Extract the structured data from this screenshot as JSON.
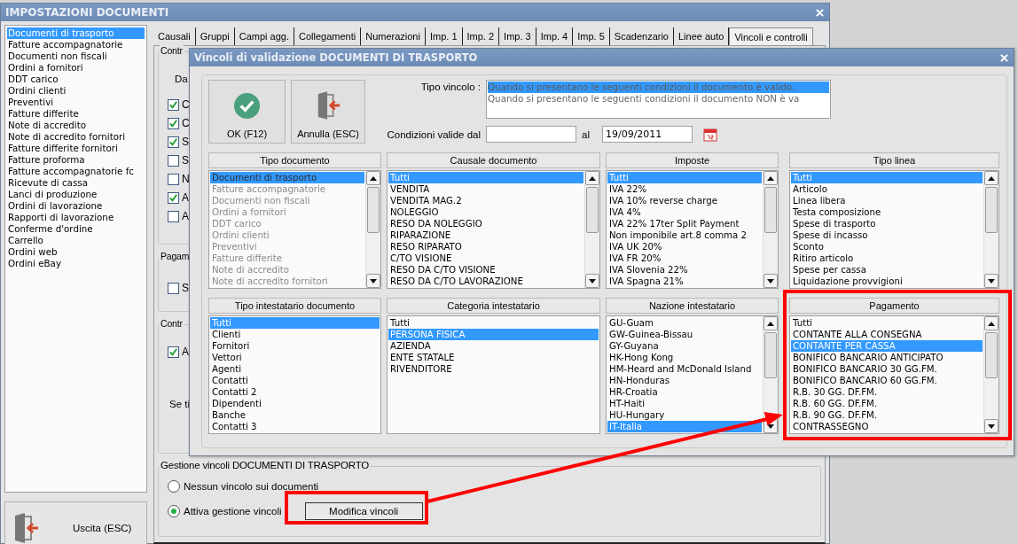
{
  "window": {
    "title": "IMPOSTAZIONI DOCUMENTI"
  },
  "document_types": [
    {
      "label": "Documenti di trasporto",
      "selected": true
    },
    {
      "label": "Fatture accompagnatorie",
      "selected": false
    },
    {
      "label": "Documenti non fiscali",
      "selected": false
    },
    {
      "label": "Ordini a fornitori",
      "selected": false
    },
    {
      "label": "DDT carico",
      "selected": false
    },
    {
      "label": "Ordini clienti",
      "selected": false
    },
    {
      "label": "Preventivi",
      "selected": false
    },
    {
      "label": "Fatture differite",
      "selected": false
    },
    {
      "label": "Note di accredito",
      "selected": false
    },
    {
      "label": "Note di accredito fornitori",
      "selected": false
    },
    {
      "label": "Fatture differite fornitori",
      "selected": false
    },
    {
      "label": "Fatture proforma",
      "selected": false
    },
    {
      "label": "Fatture accompagnatorie fc",
      "selected": false
    },
    {
      "label": "Ricevute di cassa",
      "selected": false
    },
    {
      "label": "Lanci di produzione",
      "selected": false
    },
    {
      "label": "Ordini di lavorazione",
      "selected": false
    },
    {
      "label": "Rapporti di lavorazione",
      "selected": false
    },
    {
      "label": "Conferme d'ordine",
      "selected": false
    },
    {
      "label": "Carrello",
      "selected": false
    },
    {
      "label": "Ordini web",
      "selected": false
    },
    {
      "label": "Ordini eBay",
      "selected": false
    }
  ],
  "exit_button": "Uscita (ESC)",
  "tabs": [
    {
      "label": "Causali",
      "selected": false
    },
    {
      "label": "Gruppi",
      "selected": false
    },
    {
      "label": "Campi agg.",
      "selected": false
    },
    {
      "label": "Collegamenti",
      "selected": false
    },
    {
      "label": "Numerazioni",
      "selected": false
    },
    {
      "label": "Imp. 1",
      "selected": false
    },
    {
      "label": "Imp. 2",
      "selected": false
    },
    {
      "label": "Imp. 3",
      "selected": false
    },
    {
      "label": "Imp. 4",
      "selected": false
    },
    {
      "label": "Imp. 5",
      "selected": false
    },
    {
      "label": "Scadenzario",
      "selected": false
    },
    {
      "label": "Linee auto",
      "selected": false
    },
    {
      "label": "Vincoli e controlli",
      "selected": true
    }
  ],
  "groups": [
    {
      "legend": "Contr",
      "items": [
        {
          "kind": "label",
          "text": "Da"
        },
        {
          "kind": "checkbox",
          "text": "C",
          "checked": true
        },
        {
          "kind": "checkbox",
          "text": "C",
          "checked": true
        },
        {
          "kind": "checkbox",
          "text": "S",
          "checked": true
        },
        {
          "kind": "checkbox",
          "text": "S",
          "checked": false
        },
        {
          "kind": "checkbox",
          "text": "N",
          "checked": false
        },
        {
          "kind": "checkbox",
          "text": "A",
          "checked": true
        },
        {
          "kind": "checkbox",
          "text": "A",
          "checked": false
        }
      ]
    },
    {
      "legend": "Pagam",
      "items": [
        {
          "kind": "checkbox",
          "text": "S",
          "checked": false
        }
      ]
    },
    {
      "legend": "Contr",
      "items": [
        {
          "kind": "checkbox",
          "text": "A",
          "checked": true
        },
        {
          "kind": "label",
          "text": "Se ti"
        }
      ]
    }
  ],
  "constraints_group": {
    "legend": "Gestione vincoli DOCUMENTI DI TRASPORTO",
    "options": [
      {
        "label": "Nessun vincolo sui documenti",
        "selected": false
      },
      {
        "label": "Attiva gestione vincoli",
        "selected": true
      }
    ],
    "button": "Modifica vincoli"
  },
  "dialog": {
    "title": "Vincoli di validazione DOCUMENTI DI TRASPORTO",
    "ok_button": "OK (F12)",
    "cancel_button": "Annulla (ESC)",
    "constraint_type": {
      "label": "Tipo vincolo :",
      "options": [
        {
          "label": "Quando si presentano le seguenti condizioni il documento è valido.",
          "selected": true
        },
        {
          "label": "Quando si presentano le seguenti condizioni il documento NON è va",
          "selected": false
        }
      ]
    },
    "valid_from": {
      "label": "Condizioni valide dal"
    },
    "valid_to": {
      "label": "al",
      "value": "19/09/2011"
    },
    "lists": [
      {
        "title": "Tipo documento",
        "disabled": true,
        "scrollable": true,
        "items": [
          {
            "label": "Documenti di trasporto",
            "selected": true
          },
          {
            "label": "Fatture accompagnatorie",
            "selected": false
          },
          {
            "label": "Documenti non fiscali",
            "selected": false
          },
          {
            "label": "Ordini a fornitori",
            "selected": false
          },
          {
            "label": "DDT carico",
            "selected": false
          },
          {
            "label": "Ordini clienti",
            "selected": false
          },
          {
            "label": "Preventivi",
            "selected": false
          },
          {
            "label": "Fatture differite",
            "selected": false
          },
          {
            "label": "Note di accredito",
            "selected": false
          },
          {
            "label": "Note di accredito fornitori",
            "selected": false
          }
        ]
      },
      {
        "title": "Causale documento",
        "disabled": false,
        "scrollable": true,
        "items": [
          {
            "label": "Tutti",
            "selected": true
          },
          {
            "label": "VENDITA",
            "selected": false
          },
          {
            "label": "VENDITA MAG.2",
            "selected": false
          },
          {
            "label": "NOLEGGIO",
            "selected": false
          },
          {
            "label": "RESO DA NOLEGGIO",
            "selected": false
          },
          {
            "label": "RIPARAZIONE",
            "selected": false
          },
          {
            "label": "RESO RIPARATO",
            "selected": false
          },
          {
            "label": "C/TO VISIONE",
            "selected": false
          },
          {
            "label": "RESO DA C/TO VISIONE",
            "selected": false
          },
          {
            "label": "RESO DA C/TO LAVORAZIONE",
            "selected": false
          }
        ]
      },
      {
        "title": "Imposte",
        "disabled": false,
        "scrollable": true,
        "items": [
          {
            "label": "Tutti",
            "selected": true
          },
          {
            "label": "IVA 22%",
            "selected": false
          },
          {
            "label": "IVA 10% reverse charge",
            "selected": false
          },
          {
            "label": "IVA 4%",
            "selected": false
          },
          {
            "label": "IVA 22% 17ter Split Payment",
            "selected": false
          },
          {
            "label": "Non imponibile art.8 comma 2",
            "selected": false
          },
          {
            "label": "IVA UK 20%",
            "selected": false
          },
          {
            "label": "IVA FR 20%",
            "selected": false
          },
          {
            "label": "IVA Slovenia 22%",
            "selected": false
          },
          {
            "label": "IVA Spagna 21%",
            "selected": false
          }
        ]
      },
      {
        "title": "Tipo linea",
        "disabled": false,
        "scrollable": true,
        "items": [
          {
            "label": "Tutti",
            "selected": true
          },
          {
            "label": "Articolo",
            "selected": false
          },
          {
            "label": "Linea libera",
            "selected": false
          },
          {
            "label": "Testa composizione",
            "selected": false
          },
          {
            "label": "Spese di trasporto",
            "selected": false
          },
          {
            "label": "Spese di incasso",
            "selected": false
          },
          {
            "label": "Sconto",
            "selected": false
          },
          {
            "label": "Ritiro articolo",
            "selected": false
          },
          {
            "label": "Spese per cassa",
            "selected": false
          },
          {
            "label": "Liquidazione provvigioni",
            "selected": false
          }
        ]
      },
      {
        "title": "Tipo intestatario documento",
        "disabled": false,
        "scrollable": false,
        "items": [
          {
            "label": "Tutti",
            "selected": true
          },
          {
            "label": "Clienti",
            "selected": false
          },
          {
            "label": "Fornitori",
            "selected": false
          },
          {
            "label": "Vettori",
            "selected": false
          },
          {
            "label": "Agenti",
            "selected": false
          },
          {
            "label": "Contatti",
            "selected": false
          },
          {
            "label": "Contatti 2",
            "selected": false
          },
          {
            "label": "Dipendenti",
            "selected": false
          },
          {
            "label": "Banche",
            "selected": false
          },
          {
            "label": "Contatti 3",
            "selected": false
          }
        ]
      },
      {
        "title": "Categoria intestatario",
        "disabled": false,
        "scrollable": false,
        "items": [
          {
            "label": "Tutti",
            "selected": false
          },
          {
            "label": "PERSONA FISICA",
            "selected": true
          },
          {
            "label": "AZIENDA",
            "selected": false
          },
          {
            "label": "ENTE STATALE",
            "selected": false
          },
          {
            "label": "RIVENDITORE",
            "selected": false
          }
        ]
      },
      {
        "title": "Nazione intestatario",
        "disabled": false,
        "scrollable": true,
        "items": [
          {
            "label": "GU-Guam",
            "selected": false
          },
          {
            "label": "GW-Guinea-Bissau",
            "selected": false
          },
          {
            "label": "GY-Guyana",
            "selected": false
          },
          {
            "label": "HK-Hong Kong",
            "selected": false
          },
          {
            "label": "HM-Heard and McDonald Island",
            "selected": false
          },
          {
            "label": "HN-Honduras",
            "selected": false
          },
          {
            "label": "HR-Croatia",
            "selected": false
          },
          {
            "label": "HT-Haiti",
            "selected": false
          },
          {
            "label": "HU-Hungary",
            "selected": false
          },
          {
            "label": "IT-Italia",
            "selected": true
          }
        ]
      },
      {
        "title": "Pagamento",
        "disabled": false,
        "scrollable": true,
        "items": [
          {
            "label": "Tutti",
            "selected": false
          },
          {
            "label": "CONTANTE ALLA CONSEGNA",
            "selected": false
          },
          {
            "label": "CONTANTE PER CASSA",
            "selected": true
          },
          {
            "label": "BONIFICO BANCARIO ANTICIPATO",
            "selected": false
          },
          {
            "label": "BONIFICO BANCARIO 30 GG.FM.",
            "selected": false
          },
          {
            "label": "BONIFICO BANCARIO 60 GG.FM.",
            "selected": false
          },
          {
            "label": "R.B. 30 GG. DF.FM.",
            "selected": false
          },
          {
            "label": "R.B. 60 GG. DF.FM.",
            "selected": false
          },
          {
            "label": "R.B. 90 GG. DF.FM.",
            "selected": false
          },
          {
            "label": "CONTRASSEGNO",
            "selected": false
          }
        ]
      }
    ]
  }
}
